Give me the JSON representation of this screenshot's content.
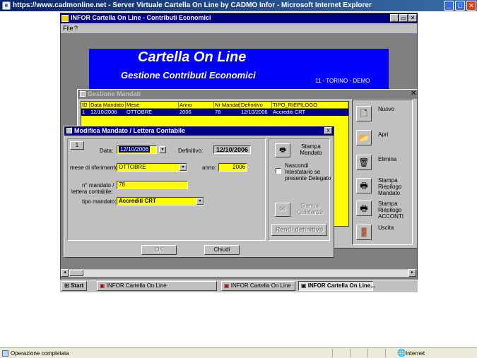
{
  "browser": {
    "title": "https://www.cadmonline.net - Server Virtuale Cartella On Line by CADMO Infor - Microsoft Internet Explorer",
    "status": "Operazione completata",
    "zone": "Internet",
    "controls": {
      "minimize": "_",
      "maximize": "□",
      "close": "✕"
    }
  },
  "access": {
    "title": "INFOR Cartella On Line - Contributi Economici",
    "controls": {
      "minimize": "_",
      "restore": "▭",
      "close": "✕"
    },
    "menu": [
      "File",
      "?"
    ]
  },
  "banner": {
    "title": "Cartella On Line",
    "subtitle": "Gestione Contributi Economici",
    "location": "11 - TORINO - DEMO"
  },
  "gestione_mandati": {
    "title": "Gestione Mandati",
    "close": "✕",
    "columns": [
      "ID",
      "Data Mandato",
      "Mese",
      "Anno",
      "Nr Mandato",
      "Definitivo",
      "TIPO_RIEPILOGO"
    ],
    "rows": [
      [
        "1",
        "12/10/2006",
        "OTTOBRE",
        "2006",
        "78",
        "12/10/2006",
        "Accrediti CRT"
      ]
    ],
    "side_buttons": [
      {
        "label": "Nuovo",
        "icon": "new-document-icon",
        "glyph": "🗋"
      },
      {
        "label": "Apri",
        "icon": "open-folder-icon",
        "glyph": "📂"
      },
      {
        "label": "Elimina",
        "icon": "trash-icon",
        "glyph": "🗑"
      },
      {
        "label": "Stampa Riepilogo Mandato",
        "icon": "printer-icon",
        "glyph": "🖶"
      },
      {
        "label": "Stampa Riepilogo ACCONTI",
        "icon": "printer-icon",
        "glyph": "🖶"
      },
      {
        "label": "Uscita",
        "icon": "exit-door-icon",
        "glyph": "🚪"
      }
    ]
  },
  "modifica_mandato": {
    "title": "Modifica Mandato / Lettera Contabile",
    "close": "x",
    "record_number": "1",
    "data_label": "Data:",
    "data_value": "12/10/2006",
    "definitivo_label": "Definitivo:",
    "definitivo_value": "12/10/2006",
    "mese_label": "mese di riferimento:",
    "mese_value": "OTTOBRE",
    "anno_label": "anno:",
    "anno_value": "2006",
    "mandato_label_1": "n° mandato /",
    "mandato_label_2": "lettera contabile:",
    "mandato_value": "78",
    "tipo_label": "tipo mandato:",
    "tipo_value": "Accrediti CRT",
    "stampa_mandato": "Stampa Mandato",
    "nascondi_1": "Nascondi",
    "nascondi_2": "Intestatario se",
    "nascondi_3": "presente Delegato",
    "nascondi_checked": false,
    "stampa_quietanze": "Stampa Quietanze",
    "rendi_definitivo": "Rendi definitivo",
    "ok": "OK",
    "chiudi": "Chiudi"
  },
  "taskbar": {
    "start": "Start",
    "items": [
      "INFOR Cartella On Line",
      "INFOR Cartella On Line",
      "INFOR Cartella On Line..."
    ]
  }
}
